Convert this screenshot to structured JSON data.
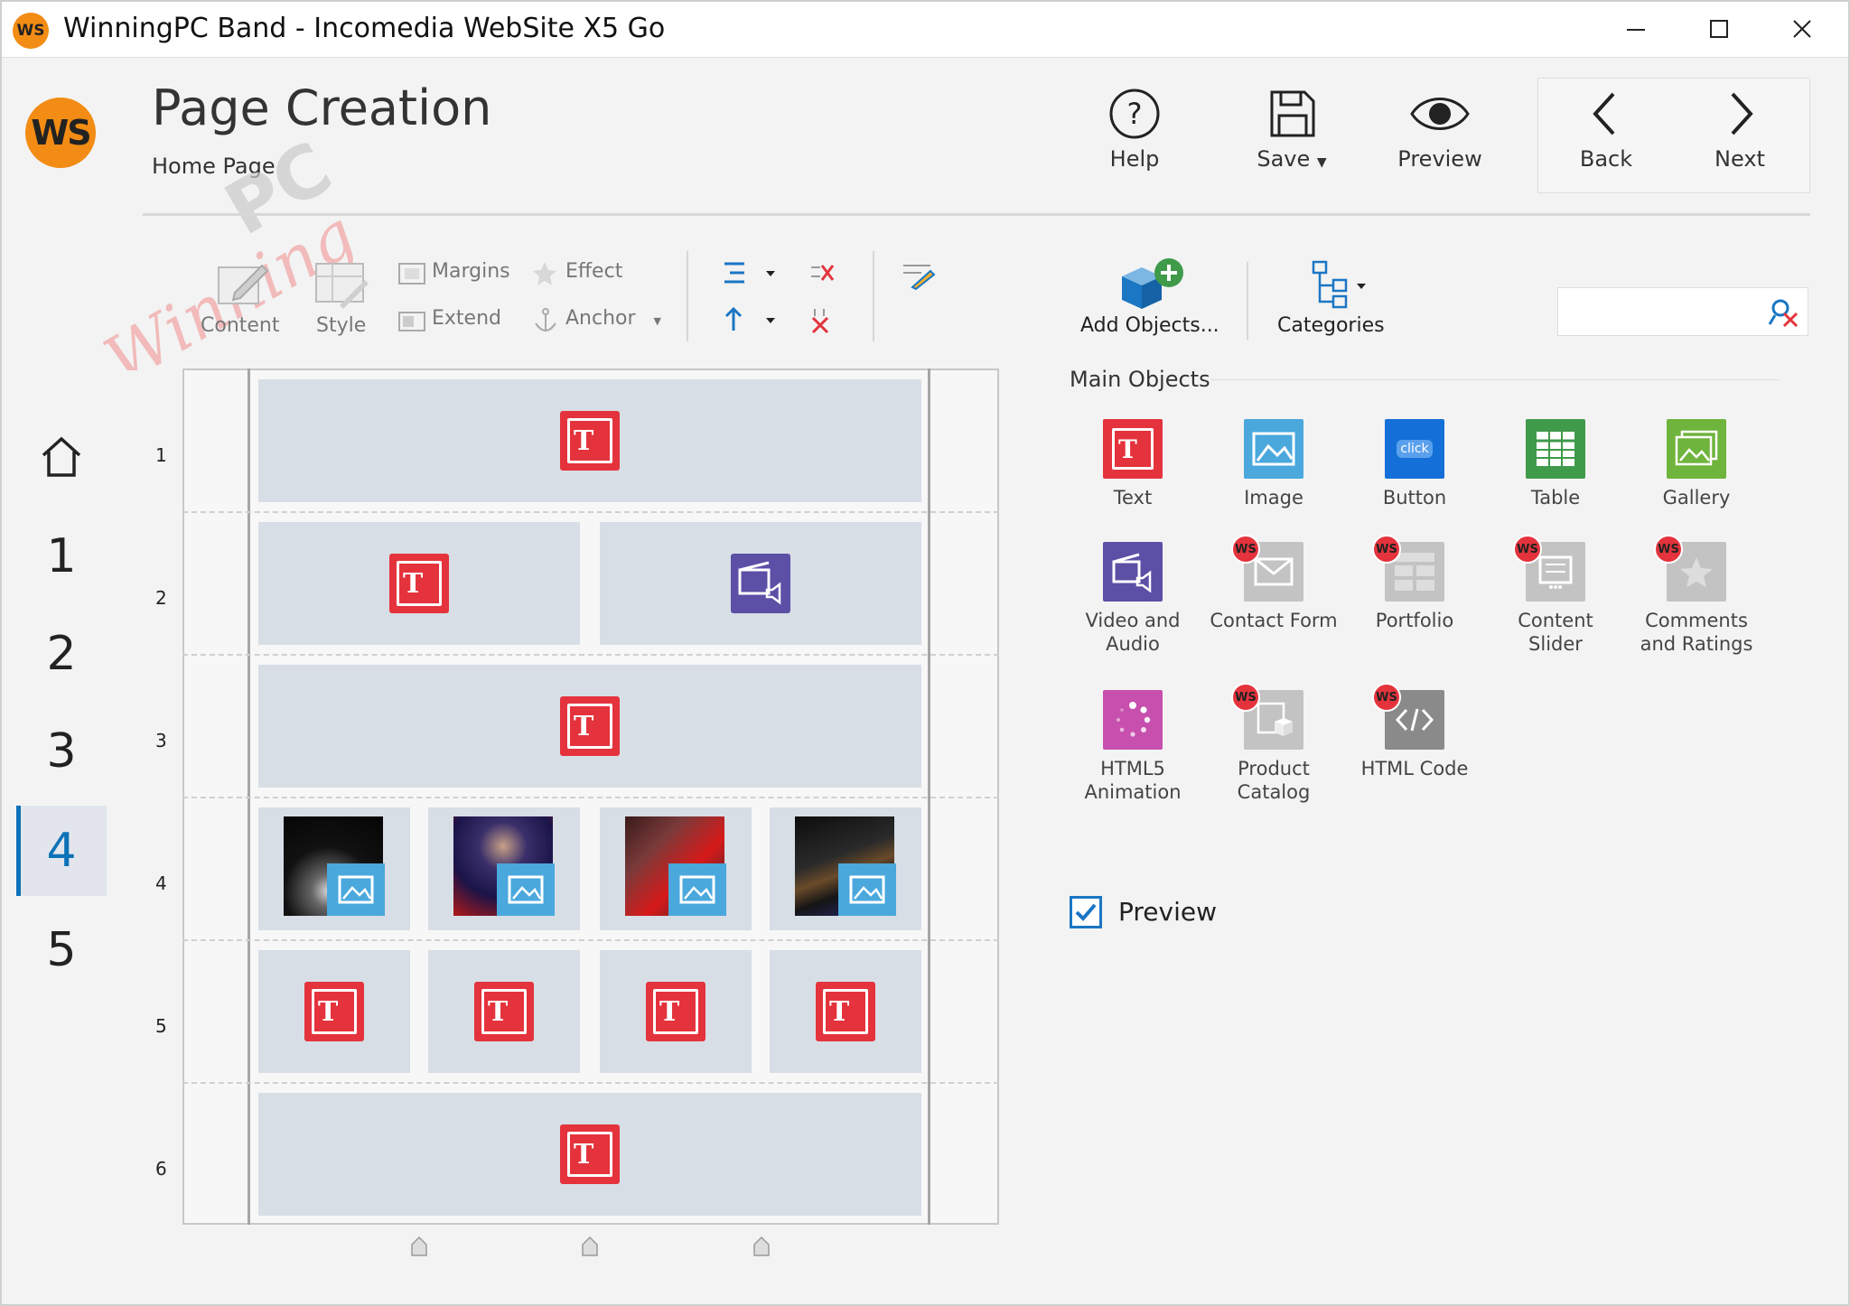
{
  "window": {
    "app_icon_text": "WS",
    "title": "WinningPC Band - Incomedia WebSite X5 Go"
  },
  "header": {
    "logo_text": "WS",
    "page_title": "Page Creation",
    "breadcrumb": "Home Page",
    "buttons": {
      "help": "Help",
      "save": "Save",
      "preview": "Preview",
      "back": "Back",
      "next": "Next"
    }
  },
  "toolbar": {
    "content": "Content",
    "style": "Style",
    "margins": "Margins",
    "extend": "Extend",
    "effect": "Effect",
    "anchor": "Anchor",
    "add_objects": "Add Objects...",
    "categories": "Categories",
    "search_placeholder": ""
  },
  "sidebar": {
    "items": [
      {
        "label": "",
        "icon": "home-icon"
      },
      {
        "label": "1"
      },
      {
        "label": "2"
      },
      {
        "label": "3"
      },
      {
        "label": "4",
        "active": true
      },
      {
        "label": "5"
      }
    ]
  },
  "grid": {
    "row_numbers": [
      "1",
      "2",
      "3",
      "4",
      "5",
      "6"
    ],
    "text_glyph": "T"
  },
  "objects": {
    "section_title": "Main Objects",
    "badge_text": "WS",
    "button_icon_text": "click",
    "items": [
      {
        "label": "Text",
        "icon": "text-object-icon",
        "color": "#e4333c"
      },
      {
        "label": "Image",
        "icon": "image-object-icon",
        "color": "#4aa8dd"
      },
      {
        "label": "Button",
        "icon": "button-object-icon",
        "color": "#1470d8"
      },
      {
        "label": "Table",
        "icon": "table-object-icon",
        "color": "#3f9a4a"
      },
      {
        "label": "Gallery",
        "icon": "gallery-object-icon",
        "color": "#6fb43c"
      },
      {
        "label": "Video and\nAudio",
        "icon": "video-audio-object-icon",
        "color": "#5b4fa6"
      },
      {
        "label": "Contact Form",
        "icon": "contact-form-object-icon",
        "color": "#b9b9b9",
        "pro": true
      },
      {
        "label": "Portfolio",
        "icon": "portfolio-object-icon",
        "color": "#b9b9b9",
        "pro": true
      },
      {
        "label": "Content\nSlider",
        "icon": "content-slider-object-icon",
        "color": "#b9b9b9",
        "pro": true
      },
      {
        "label": "Comments\nand Ratings",
        "icon": "comments-ratings-object-icon",
        "color": "#b9b9b9",
        "pro": true
      },
      {
        "label": "HTML5\nAnimation",
        "icon": "html5-animation-object-icon",
        "color": "#c74fae"
      },
      {
        "label": "Product\nCatalog",
        "icon": "product-catalog-object-icon",
        "color": "#b9b9b9",
        "pro": true
      },
      {
        "label": "HTML Code",
        "icon": "html-code-object-icon",
        "color": "#8a8a8a",
        "pro": true
      }
    ]
  },
  "preview_option": {
    "label": "Preview",
    "checked": true
  },
  "watermark": {
    "text_1": "Winning",
    "text_2": "PC"
  }
}
